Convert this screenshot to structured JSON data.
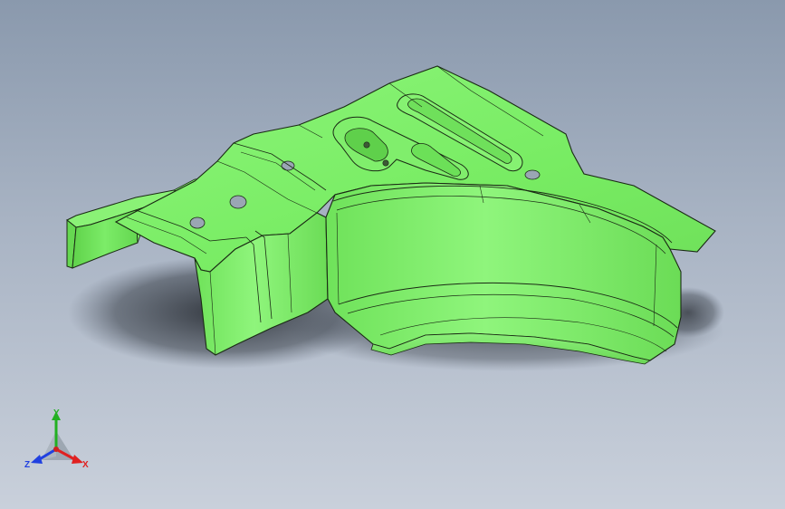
{
  "viewport": {
    "background_top": "#8a99ad",
    "background_bottom": "#c9d0db",
    "part_color": "#7ef06a",
    "part_edge_color": "#1a2a14"
  },
  "triad": {
    "x_label": "X",
    "y_label": "Y",
    "z_label": "Z",
    "x_color": "#e02020",
    "y_color": "#22b022",
    "z_color": "#2040e0"
  }
}
